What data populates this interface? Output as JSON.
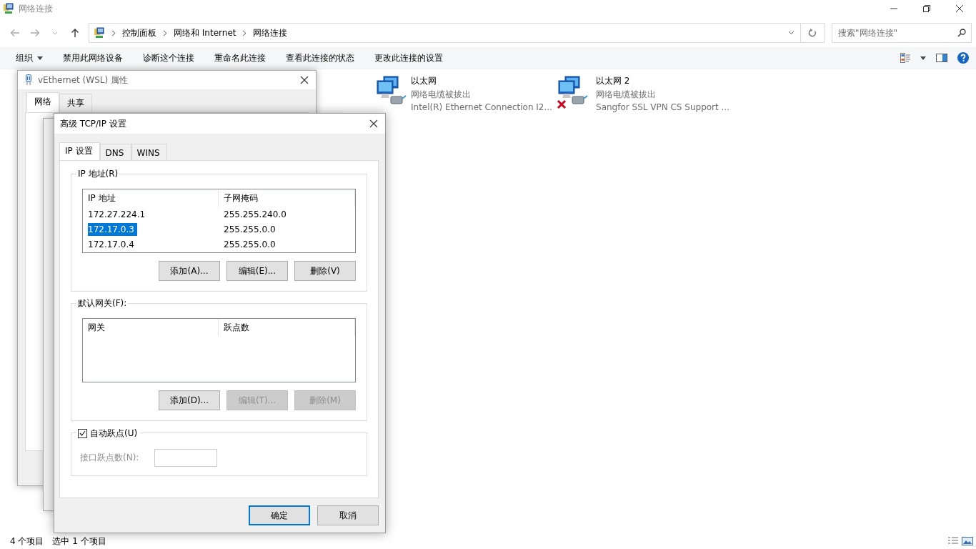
{
  "window": {
    "title": "网络连接"
  },
  "address_bar": {
    "breadcrumb": [
      "控制面板",
      "网络和 Internet",
      "网络连接"
    ]
  },
  "search": {
    "placeholder": "搜索\"网络连接\""
  },
  "toolbar": {
    "items": [
      "组织",
      "禁用此网络设备",
      "诊断这个连接",
      "重命名此连接",
      "查看此连接的状态",
      "更改此连接的设置"
    ]
  },
  "connections": [
    {
      "name": "以太网",
      "status": "网络电缆被拔出",
      "device": "Intel(R) Ethernet Connection I2...",
      "disconnected": false
    },
    {
      "name": "以太网 2",
      "status": "网络电缆被拔出",
      "device": "Sangfor SSL VPN CS Support ...",
      "disconnected": true
    }
  ],
  "status_bar": {
    "count": "4 个项目",
    "selection": "选中 1 个项目"
  },
  "properties_dialog": {
    "title": "vEthernet (WSL) 属性",
    "tabs": [
      {
        "label": "网络",
        "selected": true
      },
      {
        "label": "共享",
        "selected": false
      }
    ]
  },
  "advanced_dialog": {
    "title": "高级 TCP/IP 设置",
    "tabs": [
      {
        "label": "IP 设置",
        "selected": true
      },
      {
        "label": "DNS",
        "selected": false
      },
      {
        "label": "WINS",
        "selected": false
      }
    ],
    "ip_group": {
      "label": "IP 地址(R)",
      "columns": [
        "IP 地址",
        "子网掩码"
      ],
      "rows": [
        {
          "cells": [
            "172.27.224.1",
            "255.255.240.0"
          ],
          "selected": false
        },
        {
          "cells": [
            "172.17.0.3",
            "255.255.0.0"
          ],
          "selected": true
        },
        {
          "cells": [
            "172.17.0.4",
            "255.255.0.0"
          ],
          "selected": false
        }
      ],
      "buttons": [
        {
          "label": "添加(A)...",
          "disabled": false
        },
        {
          "label": "编辑(E)...",
          "disabled": false
        },
        {
          "label": "删除(V)",
          "disabled": false
        }
      ]
    },
    "gateway_group": {
      "label": "默认网关(F):",
      "columns": [
        "网关",
        "跃点数"
      ],
      "buttons": [
        {
          "label": "添加(D)...",
          "disabled": false
        },
        {
          "label": "编辑(T)...",
          "disabled": true
        },
        {
          "label": "删除(M)",
          "disabled": true
        }
      ]
    },
    "auto_metric": {
      "label": "自动跃点(U)",
      "checked": true
    },
    "metric_field": {
      "label": "接口跃点数(N):",
      "disabled": true
    },
    "buttons": [
      {
        "label": "确定",
        "default": true
      },
      {
        "label": "取消",
        "default": false
      }
    ]
  }
}
